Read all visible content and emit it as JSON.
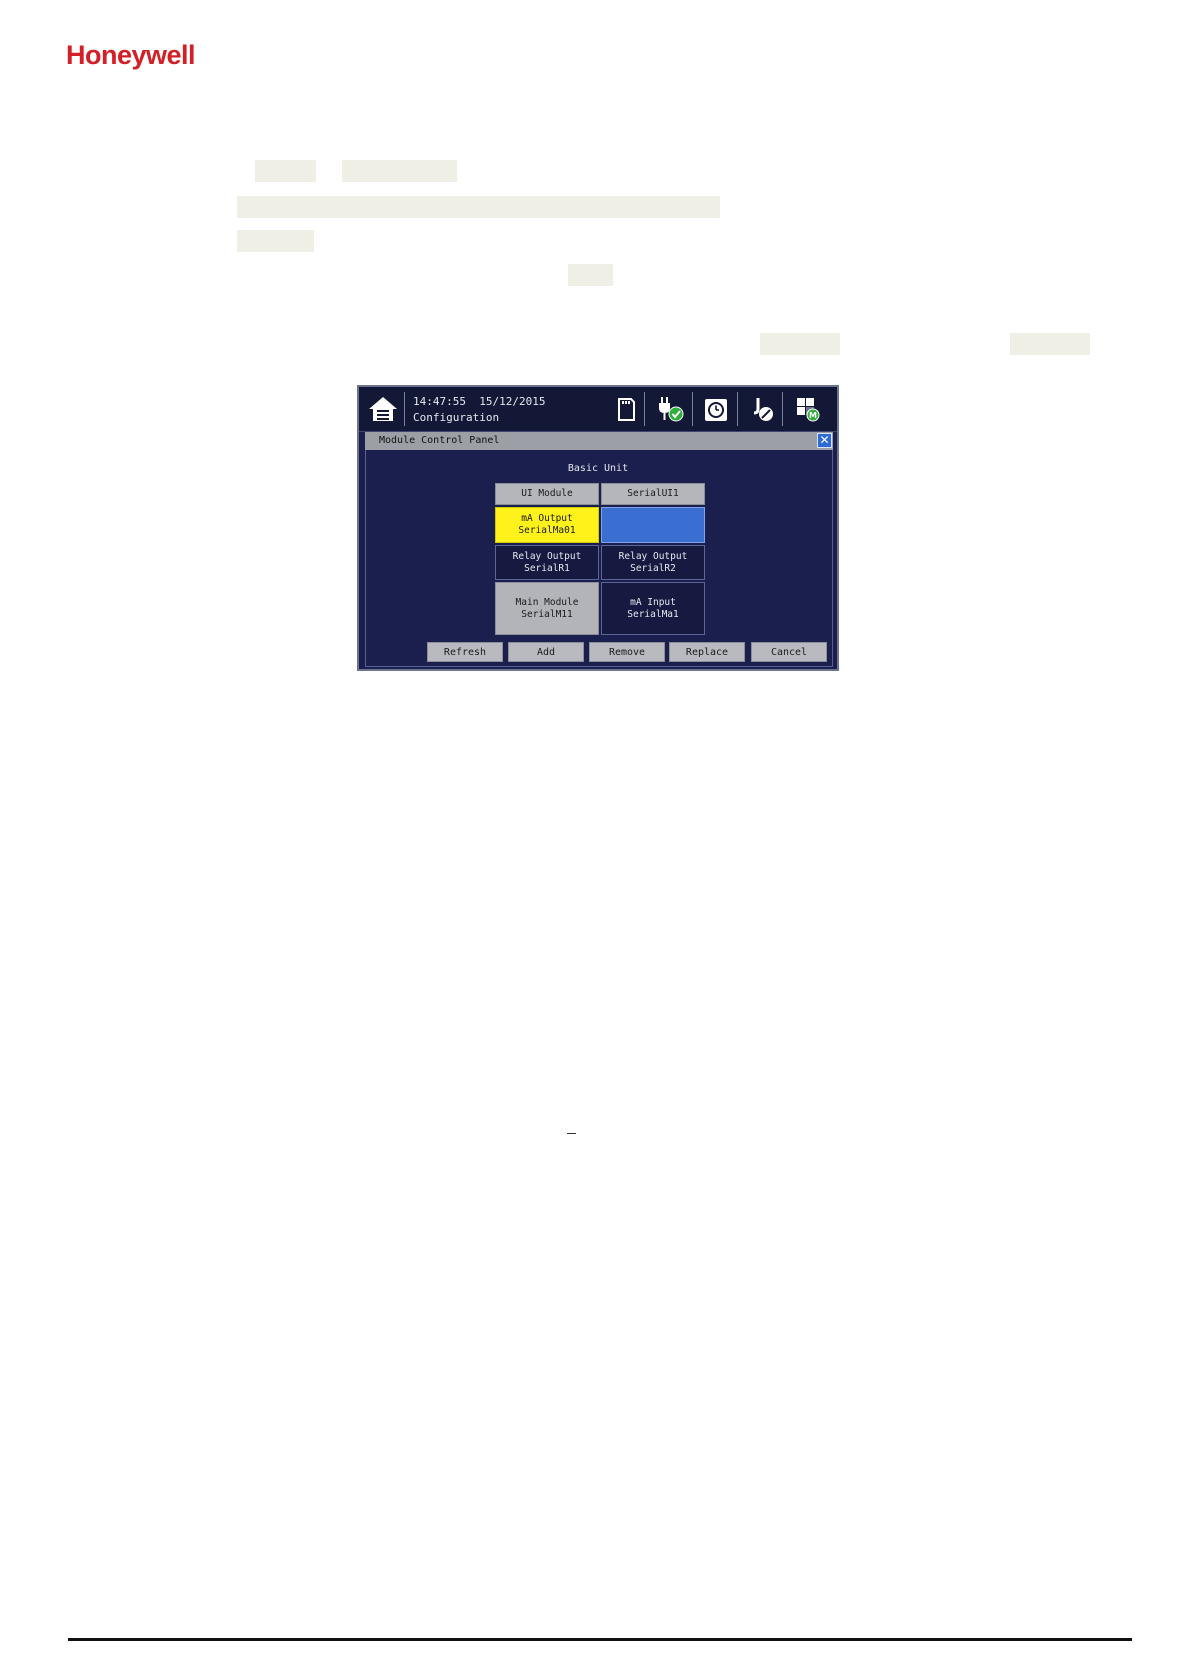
{
  "logo": {
    "text": "Honeywell",
    "color": "#d31f26"
  },
  "highlight_color": "#efefe6",
  "device": {
    "header": {
      "time": "14:47:55",
      "date": "15/12/2015",
      "mode": "Configuration"
    },
    "icons": [
      "home-icon",
      "sd-card-icon",
      "power-ok-icon",
      "alarm-clock-icon",
      "maintenance-icon",
      "module-grid-icon"
    ],
    "panel": {
      "title": "Module Control Panel",
      "close_symbol": "✕",
      "section_title": "Basic Unit",
      "columns": [
        "UI Module",
        "SerialUI1"
      ],
      "slots": [
        {
          "name": "mA Output",
          "serial": "SerialMa01",
          "state": "selected"
        },
        {
          "name": "",
          "serial": "",
          "state": "empty"
        },
        {
          "name": "Relay Output",
          "serial": "SerialR1",
          "state": "normal"
        },
        {
          "name": "Relay Output",
          "serial": "SerialR2",
          "state": "normal"
        },
        {
          "name": "Main Module",
          "serial": "SerialM11",
          "state": "disabled"
        },
        {
          "name": "mA Input",
          "serial": "SerialMa1",
          "state": "normal"
        }
      ],
      "buttons": [
        "Refresh",
        "Add",
        "Remove",
        "Replace",
        "Cancel"
      ]
    },
    "colors": {
      "background": "#1a1f4d",
      "selected": "#fff21a",
      "empty_slot": "#3a6fd1",
      "close_button": "#2e6bd6"
    }
  }
}
